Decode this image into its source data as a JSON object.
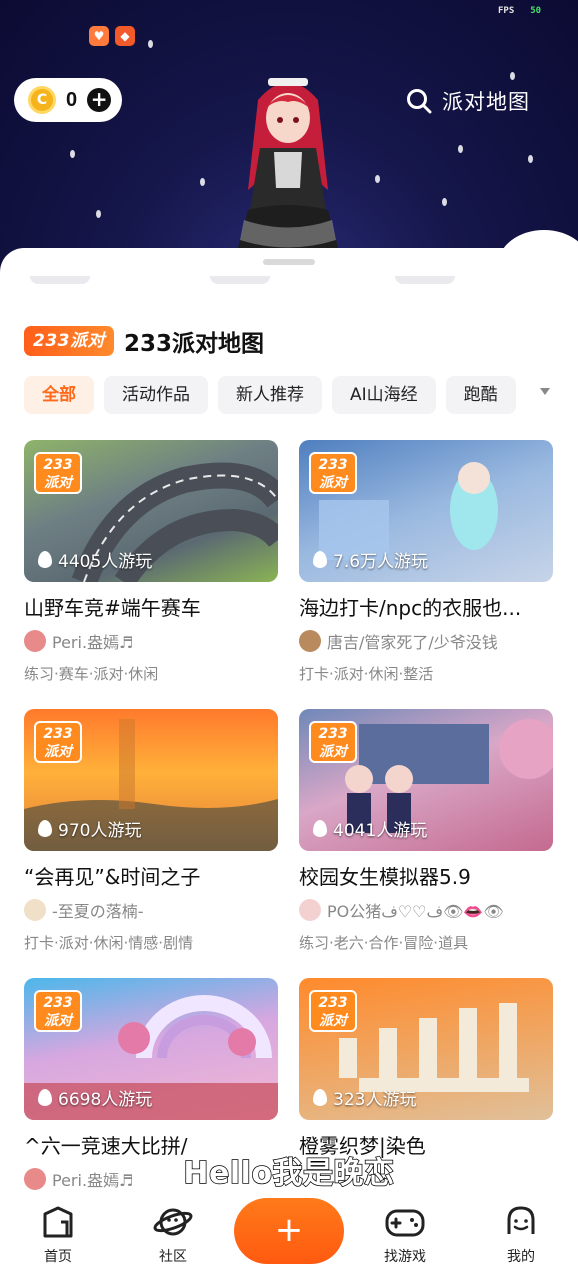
{
  "status": {
    "fps_label": "FPS",
    "fps_value": "50"
  },
  "notification_icons": [
    "heart-app-icon",
    "233-app-icon"
  ],
  "header": {
    "coin_count": "0",
    "coin_icon": "coin-icon",
    "add_icon": "plus-circle-icon",
    "search_label": "派对地图",
    "search_icon": "search-icon"
  },
  "section": {
    "badge": "233派对",
    "title": "233派对地图"
  },
  "tabs": [
    "全部",
    "活动作品",
    "新人推荐",
    "AI山海经",
    "跑酷"
  ],
  "games": [
    {
      "title": "山野车竞#端午赛车",
      "players": "4405人游玩",
      "author": "Peri.盎嫣♬",
      "tags": "练习·赛车·派对·休闲"
    },
    {
      "title": "海边打卡/npc的衣服也...",
      "players": "7.6万人游玩",
      "author": "唐吉/管家死了/少爷没钱",
      "tags": "打卡·派对·休闲·整活"
    },
    {
      "title": "“会再见”&时间之子",
      "players": "970人游玩",
      "author": "-至夏の落楠-",
      "tags": "打卡·派对·休闲·情感·剧情"
    },
    {
      "title": "校园女生模拟器5.9",
      "players": "4041人游玩",
      "author": "PO公猪ف♡♡ف👁👄👁",
      "tags": "练习·老六·合作·冒险·道具"
    },
    {
      "title": "^六一竞速大比拼/",
      "players": "6698人游玩",
      "author": "Peri.盎嫣♬",
      "tags": ""
    },
    {
      "title": "橙雾织梦|染色",
      "players": "323人游玩",
      "author": "",
      "tags": ""
    }
  ],
  "game_badge": "233\n派对",
  "subtitle": "Hello我是晚恋",
  "nav": {
    "home": "首页",
    "community": "社区",
    "create_icon": "plus-icon",
    "find_games": "找游戏",
    "me": "我的"
  },
  "colors": {
    "accent": "#ff6a1a",
    "hero_bg": "#0c0b33",
    "tab_active_bg": "#fff0e6"
  }
}
